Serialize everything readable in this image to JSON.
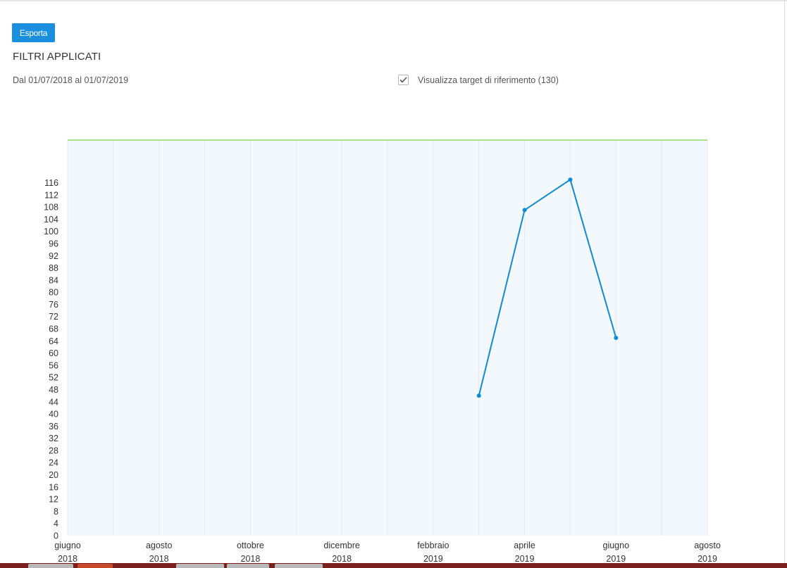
{
  "toolbar": {
    "export_label": "Esporta"
  },
  "filters": {
    "title": "FILTRI APPLICATI",
    "date_range": "Dal 01/07/2018 al 01/07/2019",
    "target_toggle": {
      "label": "Visualizza target di riferimento (130)",
      "checked": true
    }
  },
  "colors": {
    "accent": "#1a8fdf",
    "line": "#0f8bd6",
    "target_line": "#7fd34a",
    "plot_bg": "#f3f8fd"
  },
  "chart_data": {
    "type": "line",
    "title": "",
    "xlabel": "",
    "ylabel": "",
    "x_ticks": [
      {
        "month": "giugno",
        "year": "2018"
      },
      {
        "month": "agosto",
        "year": "2018"
      },
      {
        "month": "ottobre",
        "year": "2018"
      },
      {
        "month": "dicembre",
        "year": "2018"
      },
      {
        "month": "febbraio",
        "year": "2019"
      },
      {
        "month": "aprile",
        "year": "2019"
      },
      {
        "month": "giugno",
        "year": "2019"
      },
      {
        "month": "agosto",
        "year": "2019"
      }
    ],
    "x_range": [
      "2018-06",
      "2019-08"
    ],
    "ylim": [
      0,
      130
    ],
    "y_ticks": [
      0,
      4,
      8,
      12,
      16,
      20,
      24,
      28,
      32,
      36,
      40,
      44,
      48,
      52,
      56,
      60,
      64,
      68,
      72,
      76,
      80,
      84,
      88,
      92,
      96,
      100,
      104,
      108,
      112,
      116
    ],
    "target": 130,
    "series": [
      {
        "points": [
          {
            "x": "2019-03",
            "y": 46
          },
          {
            "x": "2019-04",
            "y": 107
          },
          {
            "x": "2019-05",
            "y": 117
          },
          {
            "x": "2019-06",
            "y": 65
          }
        ]
      }
    ],
    "grid": true,
    "legend": "none"
  }
}
